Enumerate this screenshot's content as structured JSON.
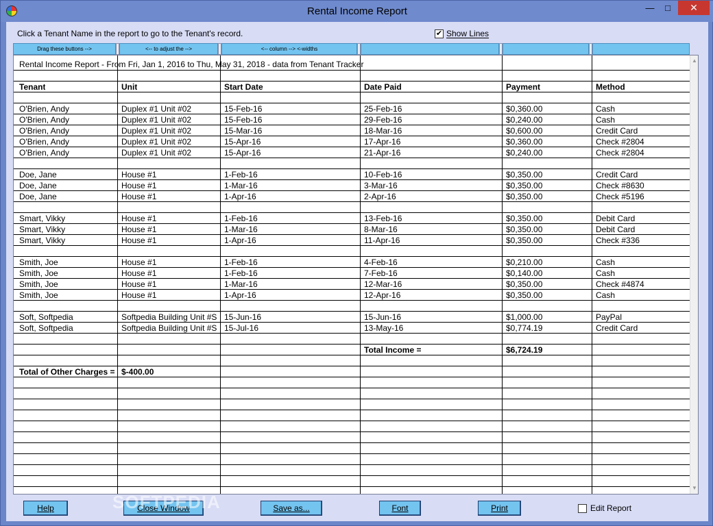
{
  "window": {
    "title": "Rental Income Report"
  },
  "hint": "Click a Tenant Name in the report to go to the Tenant's record.",
  "show_lines": {
    "label": "Show Lines",
    "checked": true
  },
  "column_buttons": [
    "Drag these buttons -->",
    "<-- to adjust the -->",
    "<-- column -->     <-widths",
    "",
    "",
    ""
  ],
  "report": {
    "caption": "Rental Income Report - From Fri, Jan 1, 2016 to Thu, May 31, 2018 - data from Tenant Tracker",
    "headers": [
      "Tenant",
      "Unit",
      "Start Date",
      "Date Paid",
      "Payment",
      "Method"
    ],
    "groups": [
      [
        [
          "O'Brien, Andy",
          "Duplex #1 Unit #02",
          "15-Feb-16",
          "25-Feb-16",
          "$0,360.00",
          "Cash"
        ],
        [
          "O'Brien, Andy",
          "Duplex #1 Unit #02",
          "15-Feb-16",
          "29-Feb-16",
          "$0,240.00",
          "Cash"
        ],
        [
          "O'Brien, Andy",
          "Duplex #1 Unit #02",
          "15-Mar-16",
          "18-Mar-16",
          "$0,600.00",
          "Credit Card"
        ],
        [
          "O'Brien, Andy",
          "Duplex #1 Unit #02",
          "15-Apr-16",
          "17-Apr-16",
          "$0,360.00",
          "Check #2804"
        ],
        [
          "O'Brien, Andy",
          "Duplex #1 Unit #02",
          "15-Apr-16",
          "21-Apr-16",
          "$0,240.00",
          "Check #2804"
        ]
      ],
      [
        [
          "Doe, Jane",
          "House #1",
          "1-Feb-16",
          "10-Feb-16",
          "$0,350.00",
          "Credit Card"
        ],
        [
          "Doe, Jane",
          "House #1",
          "1-Mar-16",
          "3-Mar-16",
          "$0,350.00",
          "Check #8630"
        ],
        [
          "Doe, Jane",
          "House #1",
          "1-Apr-16",
          "2-Apr-16",
          "$0,350.00",
          "Check #5196"
        ]
      ],
      [
        [
          "Smart, Vikky",
          "House #1",
          "1-Feb-16",
          "13-Feb-16",
          "$0,350.00",
          "Debit Card"
        ],
        [
          "Smart, Vikky",
          "House #1",
          "1-Mar-16",
          "8-Mar-16",
          "$0,350.00",
          "Debit Card"
        ],
        [
          "Smart, Vikky",
          "House #1",
          "1-Apr-16",
          "11-Apr-16",
          "$0,350.00",
          "Check #336"
        ]
      ],
      [
        [
          "Smith, Joe",
          "House #1",
          "1-Feb-16",
          "4-Feb-16",
          "$0,210.00",
          "Cash"
        ],
        [
          "Smith, Joe",
          "House #1",
          "1-Feb-16",
          "7-Feb-16",
          "$0,140.00",
          "Cash"
        ],
        [
          "Smith, Joe",
          "House #1",
          "1-Mar-16",
          "12-Mar-16",
          "$0,350.00",
          "Check #4874"
        ],
        [
          "Smith, Joe",
          "House #1",
          "1-Apr-16",
          "12-Apr-16",
          "$0,350.00",
          "Cash"
        ]
      ],
      [
        [
          "Soft, Softpedia",
          "Softpedia Building Unit #S",
          "15-Jun-16",
          "15-Jun-16",
          "$1,000.00",
          "PayPal"
        ],
        [
          "Soft, Softpedia",
          "Softpedia Building Unit #S",
          "15-Jul-16",
          "13-May-16",
          "$0,774.19",
          "Credit Card"
        ]
      ]
    ],
    "total_income_label": "Total Income =",
    "total_income_value": "$6,724.19",
    "other_charges_label": "Total of Other Charges =",
    "other_charges_value": "$-400.00"
  },
  "buttons": {
    "help": "Help",
    "close": "Close Window",
    "save": "Save as...",
    "font": "Font",
    "print": "Print"
  },
  "edit_report": {
    "label": "Edit Report",
    "checked": false
  },
  "watermark": "SOFTPEDIA"
}
